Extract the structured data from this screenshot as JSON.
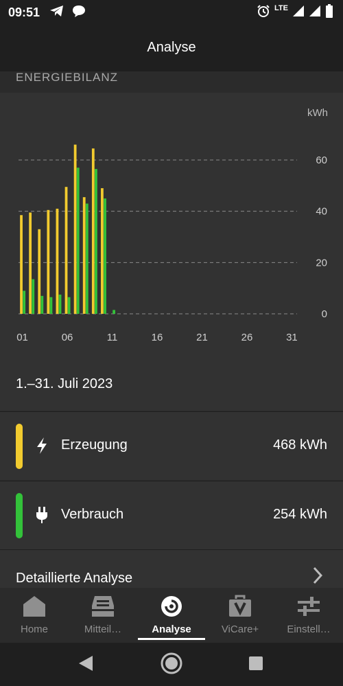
{
  "status_bar": {
    "time": "09:51",
    "network": "LTE"
  },
  "app_bar": {
    "title": "Analyse"
  },
  "section": {
    "label": "ENERGIEBILANZ"
  },
  "chart_data": {
    "type": "bar",
    "unit_label": "kWh",
    "categories": [
      "01",
      "02",
      "03",
      "04",
      "05",
      "06",
      "07",
      "08",
      "09",
      "10",
      "11",
      "12",
      "13",
      "14",
      "15",
      "16",
      "17",
      "18",
      "19",
      "20",
      "21",
      "22",
      "23",
      "24",
      "25",
      "26",
      "27",
      "28",
      "29",
      "30",
      "31"
    ],
    "x_tick_labels": [
      "01",
      "06",
      "11",
      "16",
      "21",
      "26",
      "31"
    ],
    "y_ticks": [
      0,
      20,
      40,
      60
    ],
    "ylim": [
      0,
      70
    ],
    "grid": true,
    "series": [
      {
        "color": "#f2cb2f",
        "values": [
          38.5,
          39.5,
          33,
          40.5,
          41,
          49.5,
          66,
          45.5,
          64.5,
          49,
          0,
          0,
          0,
          0,
          0,
          0,
          0,
          0,
          0,
          0,
          0,
          0,
          0,
          0,
          0,
          0,
          0,
          0,
          0,
          0,
          0
        ]
      },
      {
        "color": "#33c23a",
        "values": [
          9,
          13.5,
          7,
          6.5,
          7.5,
          6.5,
          57,
          43,
          56.5,
          45,
          1.5,
          0,
          0,
          0,
          0,
          0,
          0,
          0,
          0,
          0,
          0,
          0,
          0,
          0,
          0,
          0,
          0,
          0,
          0,
          0,
          0
        ]
      }
    ]
  },
  "period_text": "1.–31. Juli 2023",
  "legend": [
    {
      "label": "Erzeugung",
      "value": "468 kWh",
      "color": "#f2cb2f",
      "icon": "lightning-icon"
    },
    {
      "label": "Verbrauch",
      "value": "254 kWh",
      "color": "#33c23a",
      "icon": "plug-icon"
    }
  ],
  "detail": {
    "label": "Detaillierte Analyse"
  },
  "bottom_nav": [
    {
      "label": "Home",
      "icon": "home-icon",
      "active": false
    },
    {
      "label": "Mitteil…",
      "icon": "inbox-icon",
      "active": false
    },
    {
      "label": "Analyse",
      "icon": "analysis-icon",
      "active": true
    },
    {
      "label": "ViCare+",
      "icon": "vicare-bag-icon",
      "active": false
    },
    {
      "label": "Einstell…",
      "icon": "sliders-icon",
      "active": false
    }
  ]
}
